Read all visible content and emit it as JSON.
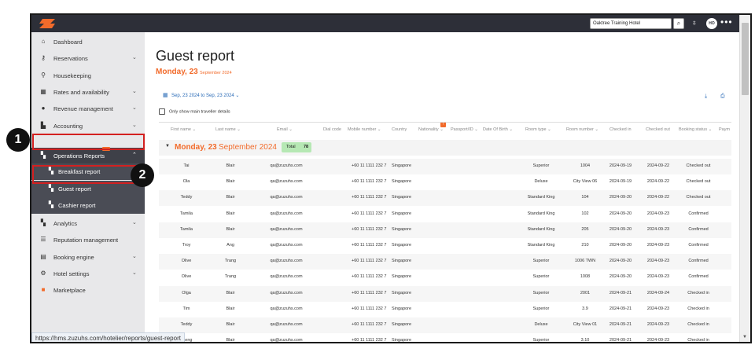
{
  "topbar": {
    "hotel_name": "Oaktree Training Hotel",
    "avatar_initials": "HO"
  },
  "sidebar": {
    "items": [
      {
        "label": "Dashboard",
        "icon": "home-icon"
      },
      {
        "label": "Reservations",
        "icon": "key-icon"
      },
      {
        "label": "Housekeeping",
        "icon": "housekeeping-icon"
      },
      {
        "label": "Rates and availability",
        "icon": "calendar-icon"
      },
      {
        "label": "Revenue management",
        "icon": "revenue-icon"
      },
      {
        "label": "Accounting",
        "icon": "accounting-icon"
      },
      {
        "label": "Operations Reports",
        "icon": "report-icon"
      },
      {
        "label": "Analytics",
        "icon": "analytics-icon"
      },
      {
        "label": "Reputation management",
        "icon": "reputation-icon"
      },
      {
        "label": "Booking engine",
        "icon": "booking-engine-icon"
      },
      {
        "label": "Hotel settings",
        "icon": "settings-icon"
      },
      {
        "label": "Marketplace",
        "icon": "marketplace-icon"
      }
    ],
    "sub_items": [
      {
        "label": "Breakfast report"
      },
      {
        "label": "Guest report"
      },
      {
        "label": "Cashier report"
      }
    ]
  },
  "callouts": [
    "1",
    "2"
  ],
  "main": {
    "title": "Guest report",
    "date_day": "Monday, 23",
    "date_month": "September 2024",
    "date_range": "Sep, 23 2024 to Sep, 23 2024",
    "only_main_label": "Only show main traveller details"
  },
  "table": {
    "headers": [
      "First name",
      "Last name",
      "Email",
      "Dial code",
      "Mobile number",
      "Country",
      "Nationality",
      "Passport/ID",
      "Date Of Birth",
      "Room type",
      "Room number",
      "Checked in",
      "Checked out",
      "Booking status",
      "Paym"
    ],
    "nationality_badge": "!",
    "group": {
      "day": "Monday, 23",
      "month": "September 2024",
      "total_label": "Total",
      "total_value": "78"
    },
    "rows": [
      [
        "Tai",
        "Blair",
        "qa@zuzuhs.com",
        "+60 11 1111 232 7",
        "Singapore",
        "Superior",
        "1004",
        "2024-09-19",
        "2024-09-22",
        "Checked out"
      ],
      [
        "Ola",
        "Blair",
        "qa@zuzuhs.com",
        "+60 11 1111 232 7",
        "Singapore",
        "Deluxe",
        "City View 06",
        "2024-09-19",
        "2024-09-22",
        "Checked out"
      ],
      [
        "Teddy",
        "Blair",
        "qa@zuzuhs.com",
        "+60 11 1111 232 7",
        "Singapore",
        "Standard King",
        "104",
        "2024-09-20",
        "2024-09-22",
        "Checked out"
      ],
      [
        "Tamila",
        "Blair",
        "qa@zuzuhs.com",
        "+60 11 1111 232 7",
        "Singapore",
        "Standard King",
        "102",
        "2024-09-20",
        "2024-09-23",
        "Confirmed"
      ],
      [
        "Tamila",
        "Blair",
        "qa@zuzuhs.com",
        "+60 11 1111 232 7",
        "Singapore",
        "Standard King",
        "205",
        "2024-09-20",
        "2024-09-23",
        "Confirmed"
      ],
      [
        "Troy",
        "Ang",
        "qa@zuzuhs.com",
        "+60 11 1111 232 7",
        "Singapore",
        "Standard King",
        "210",
        "2024-09-20",
        "2024-09-23",
        "Confirmed"
      ],
      [
        "Olive",
        "Trang",
        "qa@zuzuhs.com",
        "+60 11 1111 232 7",
        "Singapore",
        "Superior",
        "1006 TWN",
        "2024-09-20",
        "2024-09-23",
        "Confirmed"
      ],
      [
        "Olive",
        "Trang",
        "qa@zuzuhs.com",
        "+60 11 1111 232 7",
        "Singapore",
        "Superior",
        "1008",
        "2024-09-20",
        "2024-09-23",
        "Confirmed"
      ],
      [
        "Olga",
        "Blair",
        "qa@zuzuhs.com",
        "+60 11 1111 232 7",
        "Singapore",
        "Superior",
        "2001",
        "2024-09-21",
        "2024-09-24",
        "Checked in"
      ],
      [
        "Tim",
        "Blair",
        "qa@zuzuhs.com",
        "+60 11 1111 232 7",
        "Singapore",
        "Superior",
        "3.9",
        "2024-09-21",
        "2024-09-23",
        "Checked in"
      ],
      [
        "Teddy",
        "Blair",
        "qa@zuzuhs.com",
        "+60 11 1111 232 7",
        "Singapore",
        "Deluxe",
        "City View 01",
        "2024-09-21",
        "2024-09-23",
        "Checked in"
      ],
      [
        "Taeng",
        "Blair",
        "qa@zuzuhs.com",
        "+60 11 1111 232 7",
        "Singapore",
        "Superior",
        "3.10",
        "2024-09-21",
        "2024-09-23",
        "Checked in"
      ]
    ]
  },
  "status_bar": {
    "url": "https://hms.zuzuhs.com/hotelier/reports/guest-report"
  },
  "colors": {
    "accent": "#f26b2b",
    "link": "#2a6bb7",
    "highlight": "#d32020",
    "topbar": "#2d2f38"
  }
}
